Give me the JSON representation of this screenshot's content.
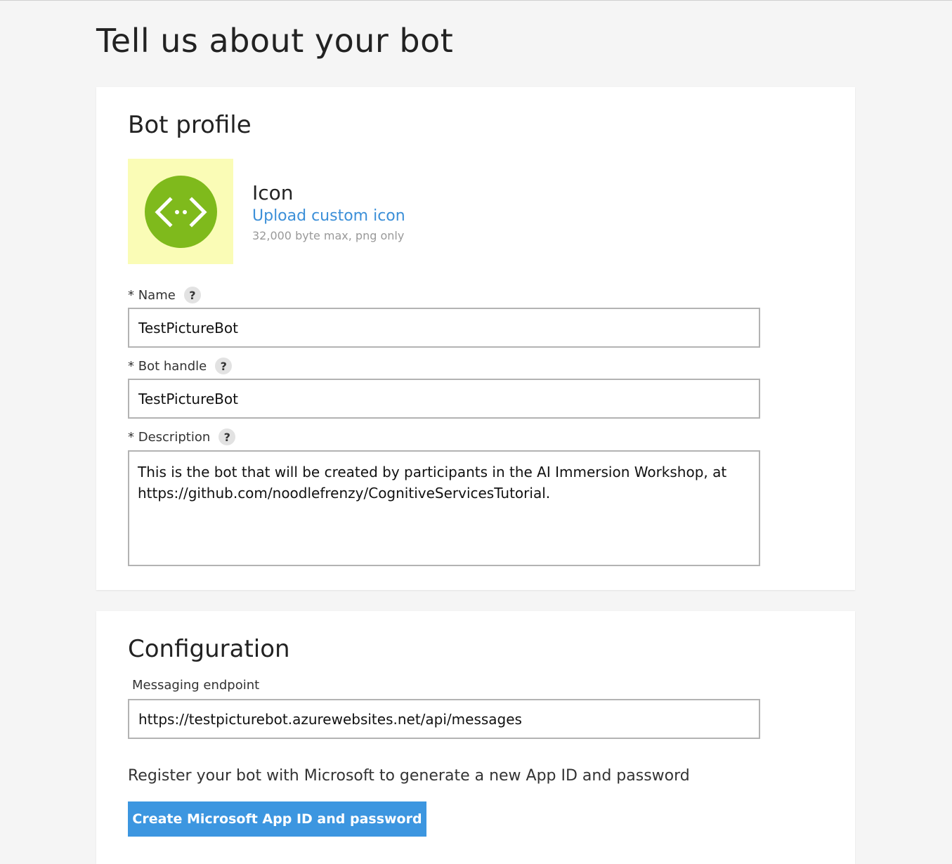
{
  "page": {
    "title": "Tell us about your bot"
  },
  "profile": {
    "heading": "Bot profile",
    "icon": {
      "label": "Icon",
      "upload_link": "Upload custom icon",
      "hint": "32,000 byte max, png only",
      "icon_name": "code-brackets-icon",
      "icon_bg_color": "#fafcb6",
      "icon_circle_color": "#7fba1c"
    },
    "fields": {
      "name": {
        "label": "* Name",
        "help": "?",
        "value": "TestPictureBot"
      },
      "handle": {
        "label": "* Bot handle",
        "help": "?",
        "value": "TestPictureBot"
      },
      "description": {
        "label": "* Description",
        "help": "?",
        "value": "This is the bot that will be created by participants in the AI Immersion Workshop, at https://github.com/noodlefrenzy/CognitiveServicesTutorial."
      }
    }
  },
  "configuration": {
    "heading": "Configuration",
    "endpoint_label": "Messaging endpoint",
    "endpoint_value": "https://testpicturebot.azurewebsites.net/api/messages",
    "register_text": "Register your bot with Microsoft to generate a new App ID and password",
    "create_button": "Create Microsoft App ID and password",
    "button_color": "#3c96e0"
  }
}
